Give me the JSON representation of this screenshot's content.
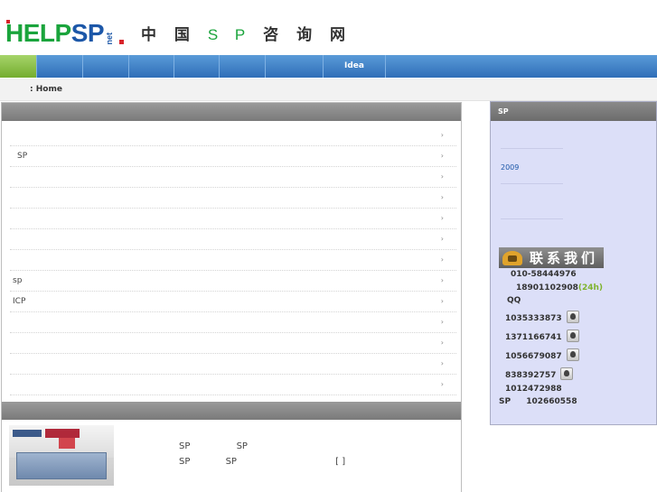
{
  "header": {
    "logo_help": "HELP",
    "logo_sp": "SP",
    "logo_net": "net",
    "slogan_cn1": "中 国",
    "slogan_sp": "S P",
    "slogan_cn2": "咨 询 网"
  },
  "nav": {
    "items": [
      "",
      "",
      "",
      "",
      "",
      "",
      "Idea",
      ""
    ]
  },
  "breadcrumb": {
    "text": ": Home"
  },
  "main": {
    "title": "",
    "list": [
      {
        "text": ""
      },
      {
        "text": "SP"
      },
      {
        "text": ""
      },
      {
        "text": ""
      },
      {
        "text": ""
      },
      {
        "text": ""
      },
      {
        "text": ""
      },
      {
        "text": "sp"
      },
      {
        "text": "ICP"
      },
      {
        "text": ""
      },
      {
        "text": ""
      },
      {
        "text": ""
      },
      {
        "text": ""
      }
    ],
    "arrow": "›",
    "intro_line1_a": "SP",
    "intro_line1_b": "SP",
    "intro_line2_a": "SP",
    "intro_line2_b": "SP",
    "intro_line2_c": "[  ]"
  },
  "side": {
    "title": "SP",
    "year": "2009",
    "contact_label": "联系我们",
    "phone1": "010-58444976",
    "phone2": "18901102908",
    "phone2_suffix": "(24h)",
    "qq_label": "QQ",
    "qq_numbers": [
      "1035333873",
      "1371166741",
      "1056679087",
      "838392757"
    ],
    "qq_extra": "1012472988",
    "sp_label": "SP",
    "sp_number": "102660558"
  },
  "colors": {
    "nav_blue": "#2f6eb8",
    "nav_green": "#74ad2e",
    "side_bg": "#dcdff8",
    "logo_green": "#1aa43c",
    "logo_blue": "#1c57a8"
  }
}
